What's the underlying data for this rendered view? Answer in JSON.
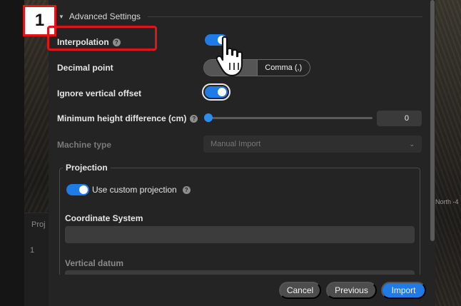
{
  "background": {
    "table_header_prefix": "Proj",
    "table_row_index": "1",
    "map_label": "North -4"
  },
  "dialog": {
    "section_title": "Advanced Settings",
    "fields": {
      "interpolation": {
        "label": "Interpolation",
        "enabled": true
      },
      "decimal_point": {
        "label": "Decimal point",
        "options": [
          "Period (.)",
          "Comma (,)"
        ],
        "visible_options": [
          "Pe",
          "Comma (,)"
        ],
        "selected": "Period (.)"
      },
      "ignore_vertical_offset": {
        "label": "Ignore vertical offset",
        "enabled": true
      },
      "min_height_difference": {
        "label": "Minimum height difference (cm)",
        "value": "0",
        "slider_fraction": 0
      },
      "machine_type": {
        "label": "Machine type",
        "value": "Manual Import",
        "disabled": true
      }
    },
    "projection": {
      "legend": "Projection",
      "use_custom_label": "Use custom projection",
      "use_custom_enabled": true,
      "coordinate_system_label": "Coordinate System",
      "coordinate_system_value": "",
      "vertical_datum_label": "Vertical datum"
    },
    "buttons": {
      "cancel": "Cancel",
      "previous": "Previous",
      "import": "Import"
    }
  },
  "annotation": {
    "step_number": "1"
  },
  "icons": {
    "help": "help-icon",
    "chevron": "chevron-down-icon",
    "cursor": "hand-pointer-icon"
  },
  "colors": {
    "accent": "#1f7be6",
    "annotation_red": "#e3131b",
    "dialog_bg": "#242424"
  }
}
